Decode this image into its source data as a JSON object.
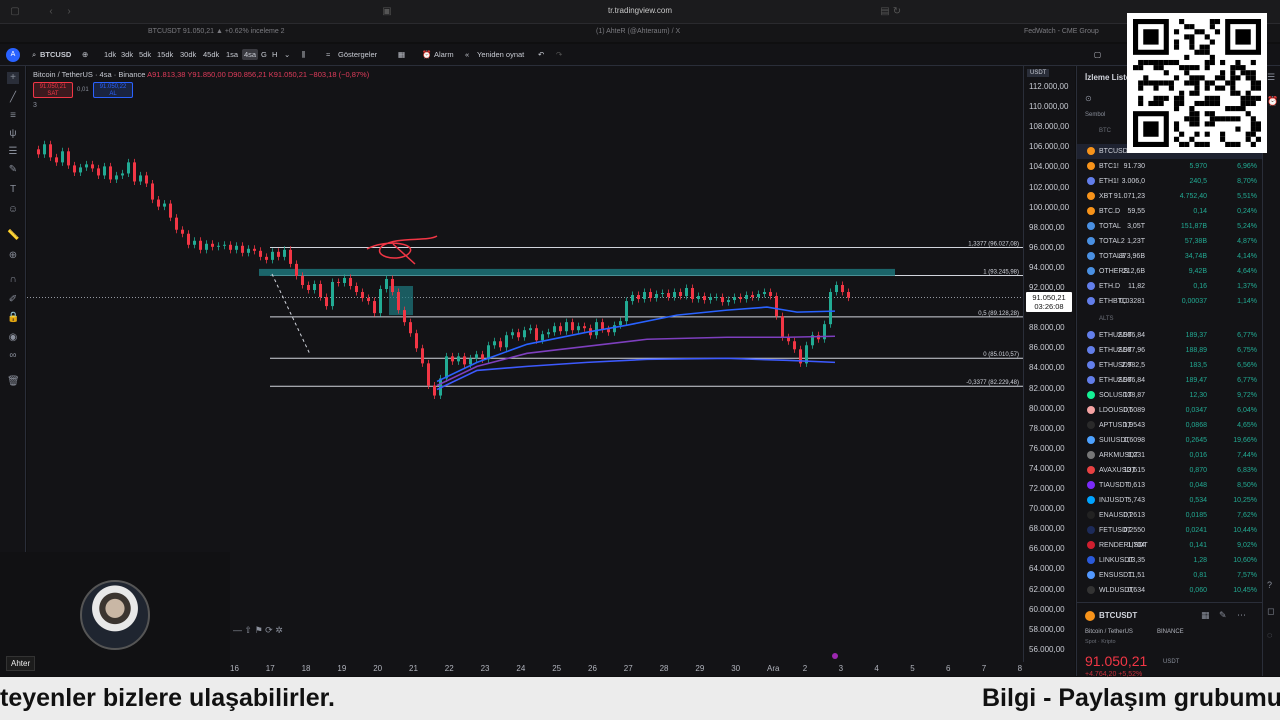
{
  "browser": {
    "url": "tr.tradingview.com",
    "tabs": [
      "BTCUSDT 91.050,21 ▲ +0.62% inceleme 2",
      "(1) AhteR (@Ahteraum) / X",
      "FedWatch - CME Group"
    ]
  },
  "toolbar": {
    "symbol": "BTCUSD",
    "intervals": [
      "1dk",
      "3dk",
      "5dk",
      "15dk",
      "30dk",
      "45dk",
      "1sa",
      "4sa",
      "G",
      "H"
    ],
    "active_interval": "4sa",
    "indicators": "Göstergeler",
    "alarm": "Alarm",
    "replay": "Yeniden oynat"
  },
  "legend": {
    "title": "Bitcoin / TetherUS · 4sa · Binance",
    "ohlc": "A91.813,38 Y91.850,00 D90.856,21 K91.050,21 −803,18 (−0,87%)",
    "sell_price": "91.050,21",
    "sell_label": "SAT",
    "spread": "0,01",
    "buy_price": "91.050,22",
    "buy_label": "AL",
    "count": "3"
  },
  "price_axis": {
    "currency": "USDT",
    "labels": [
      "112.000,00",
      "110.000,00",
      "108.000,00",
      "106.000,00",
      "104.000,00",
      "102.000,00",
      "100.000,00",
      "98.000,00",
      "96.000,00",
      "94.000,00",
      "92.000,00",
      "90.000,00",
      "88.000,00",
      "86.000,00",
      "84.000,00",
      "82.000,00",
      "80.000,00",
      "78.000,00",
      "76.000,00",
      "74.000,00",
      "72.000,00",
      "70.000,00",
      "68.000,00",
      "66.000,00",
      "64.000,00",
      "62.000,00",
      "60.000,00",
      "58.000,00",
      "56.000,00"
    ],
    "current_price": "91.050,21",
    "countdown": "03:26:08"
  },
  "fib_levels": [
    {
      "label": "1,3377 (96.027,08)",
      "price": 96027
    },
    {
      "label": "1 (93.245,98)",
      "price": 93246
    },
    {
      "label": "0,5 (89.128,28)",
      "price": 89128
    },
    {
      "label": "0 (85.010,57)",
      "price": 85011
    },
    {
      "label": "-0,3377 (82.229,48)",
      "price": 82229
    }
  ],
  "time_axis": [
    "16",
    "17",
    "18",
    "19",
    "20",
    "21",
    "22",
    "23",
    "24",
    "25",
    "26",
    "27",
    "28",
    "29",
    "30",
    "Ara",
    "2",
    "3",
    "4",
    "5",
    "6",
    "7",
    "8"
  ],
  "webcam": {
    "name": "Ahter"
  },
  "watchlist": {
    "title": "İzleme Liste",
    "header": "Sembol",
    "section_btc": "BTC",
    "section_alts": "ALTS",
    "top_symbol": "BTCUSD",
    "btc_rows": [
      {
        "sym": "BTC1!",
        "last": "91.730",
        "chg": "5.970",
        "pct": "6,96%",
        "color": "#f7931a"
      },
      {
        "sym": "ETH1!",
        "last": "3.006,0",
        "chg": "240,5",
        "pct": "8,70%",
        "color": "#627eea"
      },
      {
        "sym": "XBT",
        "last": "91.071,23",
        "chg": "4.752,40",
        "pct": "5,51%",
        "color": "#f7931a"
      },
      {
        "sym": "BTC.D",
        "last": "59,55",
        "chg": "0,14",
        "pct": "0,24%",
        "color": "#f7931a"
      },
      {
        "sym": "TOTAL",
        "last": "3,05T",
        "chg": "151,87B",
        "pct": "5,24%",
        "color": "#4a90e2"
      },
      {
        "sym": "TOTAL2",
        "last": "1,23T",
        "chg": "57,38B",
        "pct": "4,87%",
        "color": "#4a90e2"
      },
      {
        "sym": "TOTAL3",
        "last": "873,96B",
        "chg": "34,74B",
        "pct": "4,14%",
        "color": "#4a90e2"
      },
      {
        "sym": "OTHERS",
        "last": "212,6B",
        "chg": "9,42B",
        "pct": "4,64%",
        "color": "#4a90e2"
      },
      {
        "sym": "ETH.D",
        "last": "11,82",
        "chg": "0,16",
        "pct": "1,37%",
        "color": "#627eea"
      },
      {
        "sym": "ETHBTC",
        "last": "0,03281",
        "chg": "0,00037",
        "pct": "1,14%",
        "color": "#627eea"
      }
    ],
    "alt_rows": [
      {
        "sym": "ETHUSDT",
        "last": "2.986,84",
        "chg": "189,37",
        "pct": "6,77%",
        "color": "#627eea"
      },
      {
        "sym": "ETHUSDT",
        "last": "2.987,96",
        "chg": "188,89",
        "pct": "6,75%",
        "color": "#627eea"
      },
      {
        "sym": "ETHUSDT",
        "last": "2.982,5",
        "chg": "183,5",
        "pct": "6,56%",
        "color": "#627eea"
      },
      {
        "sym": "ETHUSDT",
        "last": "2.986,84",
        "chg": "189,47",
        "pct": "6,77%",
        "color": "#627eea"
      },
      {
        "sym": "SOLUSDT",
        "last": "138,87",
        "chg": "12,30",
        "pct": "9,72%",
        "color": "#14f195"
      },
      {
        "sym": "LDOUSDT",
        "last": "0,6089",
        "chg": "0,0347",
        "pct": "6,04%",
        "color": "#f5a3a3"
      },
      {
        "sym": "APTUSDT",
        "last": "1,9543",
        "chg": "0,0868",
        "pct": "4,65%",
        "color": "#2a2a2a"
      },
      {
        "sym": "SUIUSDT",
        "last": "1,6098",
        "chg": "0,2645",
        "pct": "19,66%",
        "color": "#4da2ff"
      },
      {
        "sym": "ARKMUSDT",
        "last": "0,231",
        "chg": "0,016",
        "pct": "7,44%",
        "color": "#777"
      },
      {
        "sym": "AVAXUSDT",
        "last": "13,615",
        "chg": "0,870",
        "pct": "6,83%",
        "color": "#e84142"
      },
      {
        "sym": "TIAUSDT",
        "last": "0,613",
        "chg": "0,048",
        "pct": "8,50%",
        "color": "#7b2bf9"
      },
      {
        "sym": "INJUSDT",
        "last": "5,743",
        "chg": "0,534",
        "pct": "10,25%",
        "color": "#00a3ff"
      },
      {
        "sym": "ENAUSDT",
        "last": "0,2613",
        "chg": "0,0185",
        "pct": "7,62%",
        "color": "#222"
      },
      {
        "sym": "FETUSDT",
        "last": "0,2550",
        "chg": "0,0241",
        "pct": "10,44%",
        "color": "#1d2b5a"
      },
      {
        "sym": "RENDERUSDT",
        "last": "1,704",
        "chg": "0,141",
        "pct": "9,02%",
        "color": "#cf1f2f"
      },
      {
        "sym": "LINKUSDT",
        "last": "13,35",
        "chg": "1,28",
        "pct": "10,60%",
        "color": "#2a5ada"
      },
      {
        "sym": "ENSUSDT",
        "last": "11,51",
        "chg": "0,81",
        "pct": "7,57%",
        "color": "#5298ff"
      },
      {
        "sym": "WLDUSDT",
        "last": "0,634",
        "chg": "0,060",
        "pct": "10,45%",
        "color": "#333"
      }
    ],
    "detail_symbol": "BTCUSDT",
    "detail_name": "Bitcoin / TetherUS",
    "detail_exchange": "BINANCE",
    "detail_type": "Spot · Kripto",
    "detail_price": "91.050,21",
    "detail_ccy": "USDT",
    "detail_change": "+4.764,20 +5,52%"
  },
  "ticker": {
    "left": "teyenler bizlere ulaşabilirler.",
    "right": "Bilgi - Paylaşım grubumu"
  },
  "colors": {
    "up": "#22ab94",
    "down": "#f23645",
    "bg": "#131316"
  }
}
